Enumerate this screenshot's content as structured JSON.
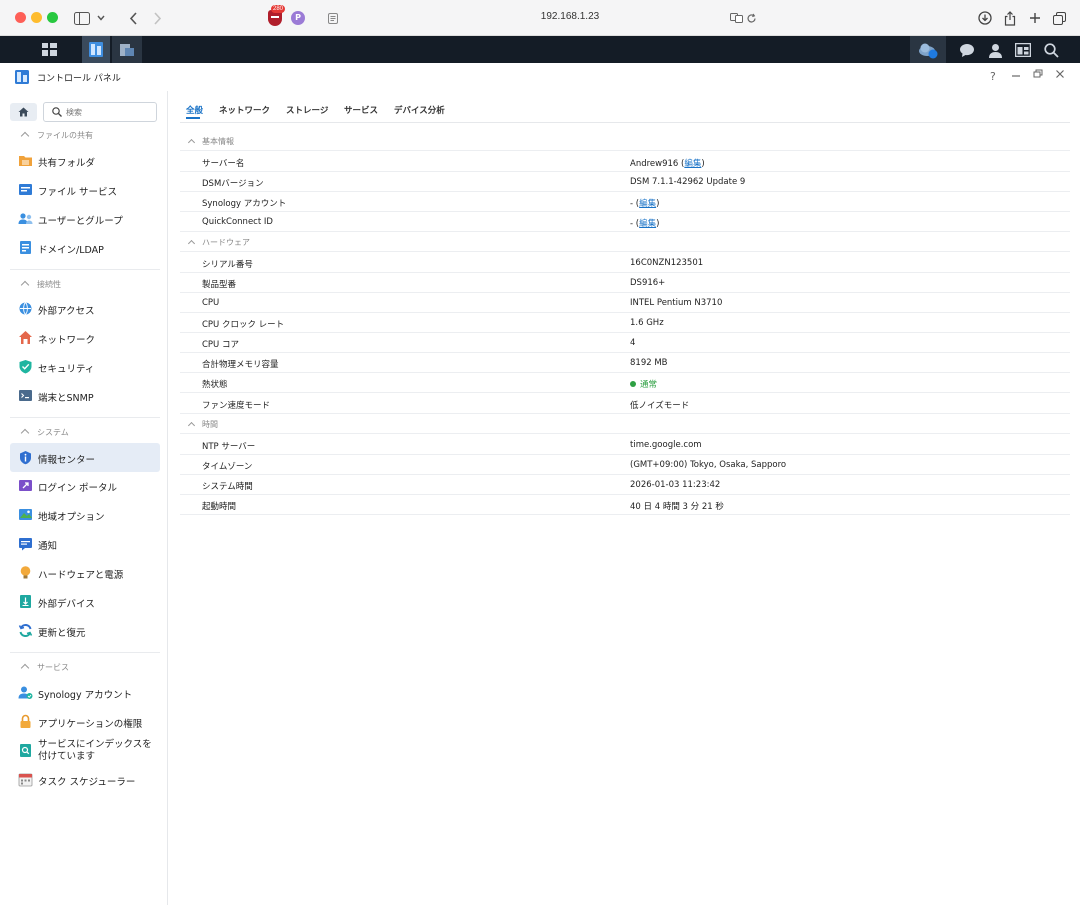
{
  "browser": {
    "url": "192.168.1.23",
    "extension_badge": "280"
  },
  "window": {
    "title": "コントロール パネル",
    "help_label": "?"
  },
  "sidebar": {
    "search_placeholder": "検索",
    "sections": [
      {
        "title": "ファイルの共有",
        "items": [
          "共有フォルダ",
          "ファイル サービス",
          "ユーザーとグループ",
          "ドメイン/LDAP"
        ]
      },
      {
        "title": "接続性",
        "items": [
          "外部アクセス",
          "ネットワーク",
          "セキュリティ",
          "端末とSNMP"
        ]
      },
      {
        "title": "システム",
        "items": [
          "情報センター",
          "ログイン ポータル",
          "地域オプション",
          "通知",
          "ハードウェアと電源",
          "外部デバイス",
          "更新と復元"
        ]
      },
      {
        "title": "サービス",
        "items": [
          "Synology アカウント",
          "アプリケーションの権限",
          "サービスにインデックスを付けています",
          "タスク スケジューラー"
        ]
      }
    ],
    "selected": "情報センター"
  },
  "tabs": [
    "全般",
    "ネットワーク",
    "ストレージ",
    "サービス",
    "デバイス分析"
  ],
  "active_tab": "全般",
  "info": {
    "groups": [
      {
        "title": "基本情報",
        "rows": [
          {
            "label": "サーバー名",
            "value": "Andrew916 (",
            "link": "編集",
            "suffix": ")"
          },
          {
            "label": "DSMバージョン",
            "value": "DSM 7.1.1-42962 Update 9"
          },
          {
            "label": "Synology アカウント",
            "value": "- (",
            "link": "編集",
            "suffix": ")"
          },
          {
            "label": "QuickConnect ID",
            "value": "- (",
            "link": "編集",
            "suffix": ")"
          }
        ]
      },
      {
        "title": "ハードウェア",
        "rows": [
          {
            "label": "シリアル番号",
            "value": "16C0NZN123501"
          },
          {
            "label": "製品型番",
            "value": "DS916+"
          },
          {
            "label": "CPU",
            "value": "INTEL Pentium N3710"
          },
          {
            "label": "CPU クロック レート",
            "value": "1.6 GHz"
          },
          {
            "label": "CPU コア",
            "value": "4"
          },
          {
            "label": "合計物理メモリ容量",
            "value": "8192 MB"
          },
          {
            "label": "熱状態",
            "value": "通常",
            "status_color": "#2ea043"
          },
          {
            "label": "ファン速度モード",
            "value": "低ノイズモード"
          }
        ]
      },
      {
        "title": "時間",
        "rows": [
          {
            "label": "NTP サーバー",
            "value": "time.google.com"
          },
          {
            "label": "タイムゾーン",
            "value": "(GMT+09:00) Tokyo, Osaka, Sapporo"
          },
          {
            "label": "システム時間",
            "value": "2026-01-03 11:23:42"
          },
          {
            "label": "起動時間",
            "value": "40 日 4 時間 3 分 21 秒"
          }
        ]
      }
    ]
  },
  "colors": {
    "accent": "#1a73c7",
    "taskbar": "#141c26",
    "selected_bg": "#e5ecf6",
    "status_good": "#2ea043"
  }
}
